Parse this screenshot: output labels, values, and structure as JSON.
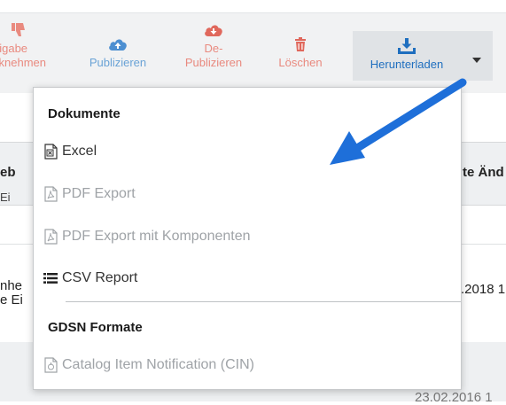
{
  "toolbar": {
    "release": {
      "line1": "eigabe",
      "line2": "cknehmen",
      "icon": "thumbs-down-icon"
    },
    "publish": {
      "label": "Publizieren",
      "icon": "cloud-upload-icon"
    },
    "unpublish": {
      "line1": "De-",
      "line2": "Publizieren",
      "icon": "cloud-download-icon"
    },
    "delete": {
      "label": "Löschen",
      "icon": "trash-icon"
    },
    "download": {
      "label": "Herunterladen",
      "icon": "download-tray-icon"
    }
  },
  "table": {
    "header_left": "eb",
    "header_sub_left": "Ei",
    "header_right": "te Änd",
    "row1_line1": "nhe",
    "row1_line2": "e Ei",
    "row1_date": ".2018 1",
    "row2_date": "23.02.2016 1"
  },
  "menu": {
    "section1_title": "Dokumente",
    "items": [
      {
        "label": "Excel",
        "icon": "excel-file-icon",
        "enabled": true
      },
      {
        "label": "PDF Export",
        "icon": "pdf-file-icon",
        "enabled": false
      },
      {
        "label": "PDF Export mit Komponenten",
        "icon": "pdf-file-icon",
        "enabled": false
      },
      {
        "label": "CSV Report",
        "icon": "list-icon",
        "enabled": true
      }
    ],
    "section2_title": "GDSN Formate",
    "gdsn_items": [
      {
        "label": "Catalog Item Notification (CIN)",
        "icon": "xml-file-icon",
        "enabled": false
      }
    ]
  },
  "colors": {
    "toolbar_bg": "#f1f2f3",
    "active_button_bg": "#e0e3e6",
    "red_action": "#e98a7f",
    "blue_action": "#1f6fbf",
    "arrow": "#1e6fd9",
    "disabled_text": "#9fa3a7"
  }
}
